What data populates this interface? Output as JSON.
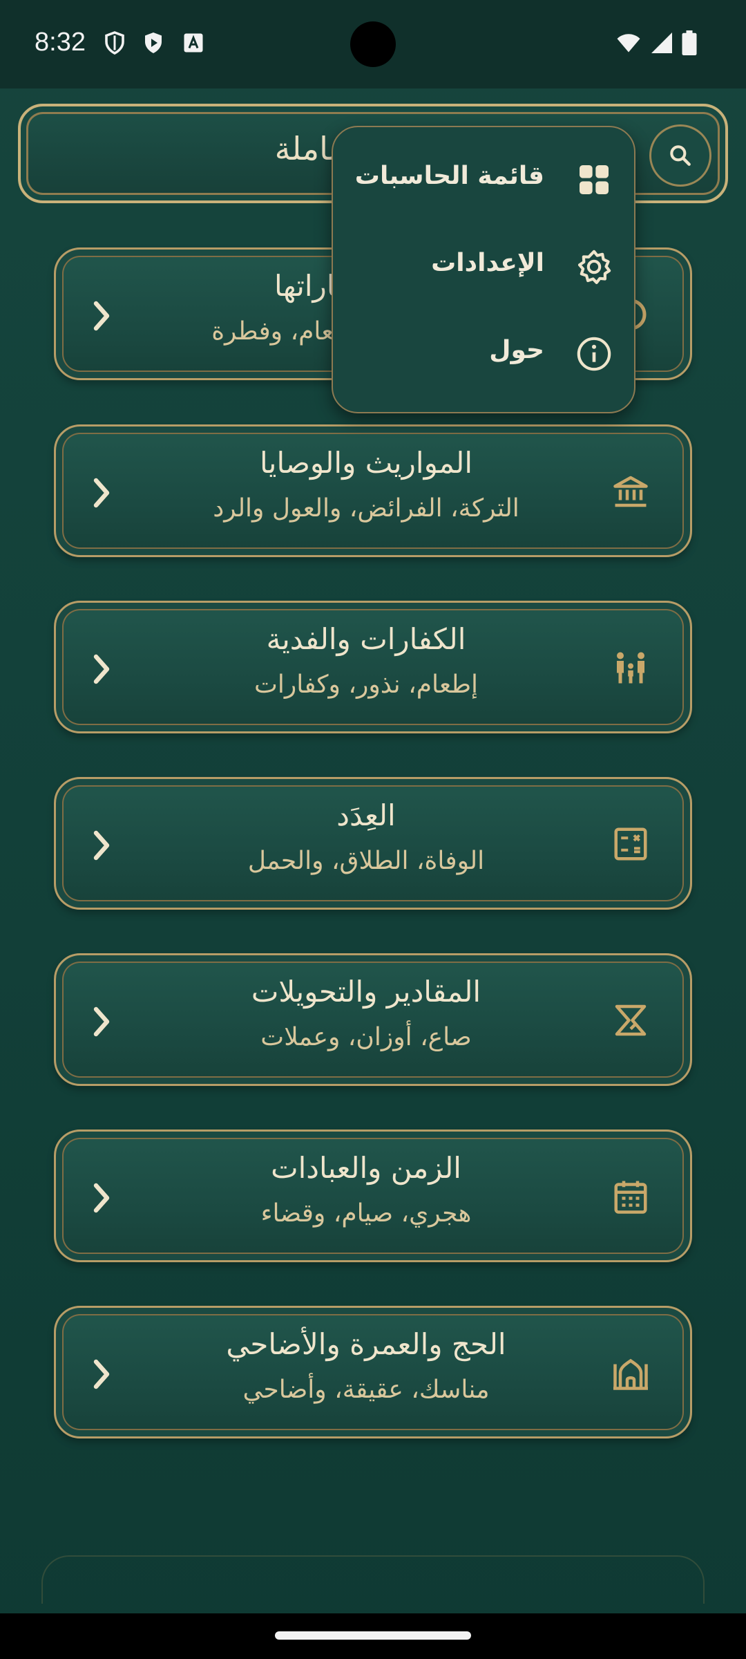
{
  "status_bar": {
    "time": "8:32"
  },
  "header": {
    "title": "الحاسبة الشرعية الشاملة",
    "search_icon": "search-icon"
  },
  "cards": [
    {
      "title": "الزكاة وكفاراتها",
      "subtitle": "أموال، عروض، إطعام، وفطرة",
      "icon": "coins-icon"
    },
    {
      "title": "المواريث والوصايا",
      "subtitle": "التركة، الفرائض، والعول والرد",
      "icon": "bank-icon"
    },
    {
      "title": "الكفارات والفدية",
      "subtitle": "إطعام، نذور، وكفارات",
      "icon": "family-icon"
    },
    {
      "title": "العِدَد",
      "subtitle": "الوفاة، الطلاق، والحمل",
      "icon": "calculator-icon"
    },
    {
      "title": "المقادير والتحويلات",
      "subtitle": "صاع، أوزان، وعملات",
      "icon": "scale-icon"
    },
    {
      "title": "الزمن والعبادات",
      "subtitle": "هجري، صيام، وقضاء",
      "icon": "calendar-icon"
    },
    {
      "title": "الحج والعمرة والأضاحي",
      "subtitle": "مناسك، عقيقة، وأضاحي",
      "icon": "mosque-icon"
    }
  ],
  "menu": {
    "items": [
      {
        "label": "قائمة الحاسبات",
        "icon": "grid-icon"
      },
      {
        "label": "الإعدادات",
        "icon": "gear-icon"
      },
      {
        "label": "حول",
        "icon": "info-icon"
      }
    ]
  },
  "colors": {
    "background": "#16453d",
    "gold": "#c9b27a",
    "text": "#efe5cc"
  }
}
